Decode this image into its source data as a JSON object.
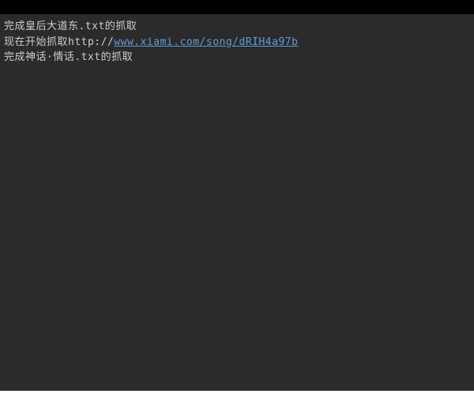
{
  "terminal": {
    "lines": [
      {
        "prefix": "完成皇后大道东.txt的抓取",
        "link": null,
        "suffix": null
      },
      {
        "prefix": "现在开始抓取http://",
        "link": "www.xiami.com/song/dRIH4a97b",
        "suffix": null
      },
      {
        "prefix": "完成神话·情话.txt的抓取",
        "link": null,
        "suffix": null
      }
    ]
  }
}
